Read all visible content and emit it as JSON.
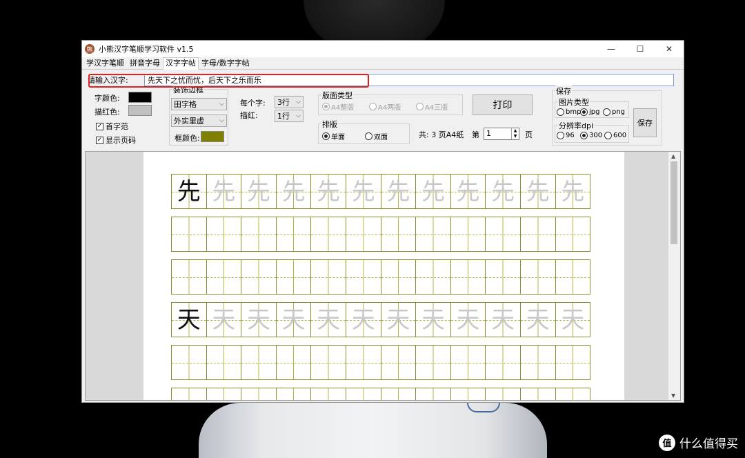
{
  "window": {
    "title": "小熊汉字笔顺学习软件 v1.5",
    "icon": "bear-icon"
  },
  "window_controls": {
    "minimize": "—",
    "maximize": "☐",
    "close": "✕"
  },
  "tabs": [
    {
      "label": "学汉字笔顺",
      "active": false
    },
    {
      "label": "拼音字母",
      "active": false
    },
    {
      "label": "汉字字帖",
      "active": true
    },
    {
      "label": "字母/数字字帖",
      "active": false
    }
  ],
  "input": {
    "label": "请输入汉字:",
    "value": "先天下之忧而忧，后天下之乐而乐"
  },
  "colors": {
    "char_color": "#000000",
    "trace_color": "#c0c0c0",
    "frame_color": "#808000",
    "highlight": "#e0201c"
  },
  "options": {
    "char_color_label": "字颜色:",
    "trace_color_label": "描红色:",
    "show_first_label": "首字范",
    "show_first_checked": "✓",
    "show_page_label": "显示页码",
    "show_page_checked": "✓"
  },
  "decoration": {
    "title": "装饰边框",
    "grid_type": "田字格",
    "line_style": "外实里虚",
    "frame_color_label": "框颜色:"
  },
  "per_char": {
    "label": "每个字:",
    "value": "3行"
  },
  "trace": {
    "label": "描红:",
    "value": "1行"
  },
  "layout_type": {
    "title": "版面类型",
    "options": [
      {
        "label": "A4整版",
        "selected": true
      },
      {
        "label": "A4两版",
        "selected": false
      },
      {
        "label": "A4三版",
        "selected": false
      }
    ]
  },
  "arrangement": {
    "title": "排版",
    "options": [
      {
        "label": "单面",
        "selected": true
      },
      {
        "label": "双面",
        "selected": false
      }
    ]
  },
  "print_button": "打印",
  "pages": {
    "total_text": "共: 3 页A4纸",
    "page_label": "第",
    "page_value": "1",
    "page_unit": "页"
  },
  "save": {
    "title": "保存",
    "image_type_title": "图片类型",
    "image_types": [
      {
        "label": "bmp",
        "selected": false
      },
      {
        "label": "jpg",
        "selected": true
      },
      {
        "label": "png",
        "selected": false
      }
    ],
    "dpi_title": "分辨率dpi",
    "dpi_options": [
      {
        "label": "96",
        "selected": false
      },
      {
        "label": "300",
        "selected": true
      },
      {
        "label": "600",
        "selected": false
      }
    ],
    "save_button": "保存"
  },
  "practice_rows": [
    {
      "char": "先",
      "cells": 12
    },
    {
      "char": "",
      "cells": 12
    },
    {
      "char": "",
      "cells": 12
    },
    {
      "char": "天",
      "cells": 12
    },
    {
      "char": "",
      "cells": 12
    },
    {
      "char": "",
      "cells": 12
    }
  ],
  "watermark": {
    "icon": "值",
    "text": "什么值得买"
  }
}
